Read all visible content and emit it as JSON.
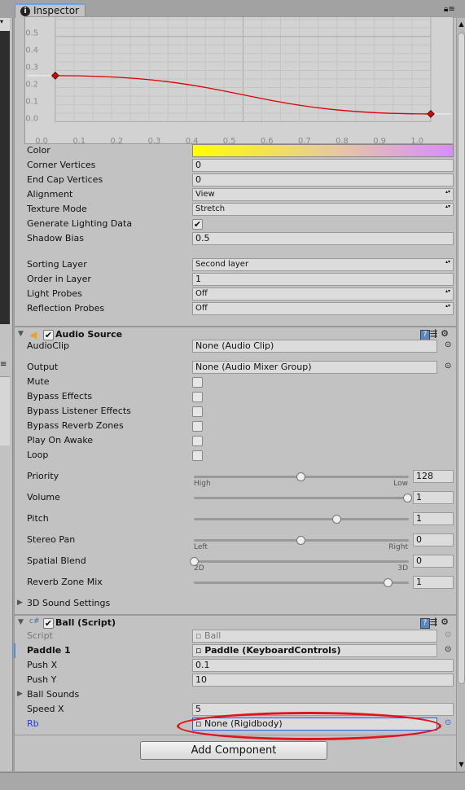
{
  "window": {
    "tab_label": "Inspector",
    "tab_icon": "info-icon"
  },
  "curve": {
    "chart_data": {
      "type": "line",
      "x_ticks": [
        "0.0",
        "0.1",
        "0.2",
        "0.3",
        "0.4",
        "0.5",
        "0.6",
        "0.7",
        "0.8",
        "0.9",
        "1.0"
      ],
      "y_ticks": [
        "0.0",
        "0.1",
        "0.2",
        "0.3",
        "0.4",
        "0.5"
      ],
      "xlim": [
        0,
        1
      ],
      "ylim": [
        0,
        0.5
      ],
      "keys": [
        {
          "x": 0,
          "y": 0.27
        },
        {
          "x": 1,
          "y": 0.045
        }
      ],
      "color": "#e00000",
      "grid": true
    }
  },
  "line_renderer": {
    "rows": [
      {
        "label": "Color",
        "kind": "gradient",
        "colors": [
          "#ffff00",
          "#d88cff"
        ]
      },
      {
        "label": "Corner Vertices",
        "kind": "text",
        "value": "0"
      },
      {
        "label": "End Cap Vertices",
        "kind": "text",
        "value": "0"
      },
      {
        "label": "Alignment",
        "kind": "dropdown",
        "value": "View"
      },
      {
        "label": "Texture Mode",
        "kind": "dropdown",
        "value": "Stretch"
      },
      {
        "label": "Generate Lighting Data",
        "kind": "checkbox",
        "checked": true
      },
      {
        "label": "Shadow Bias",
        "kind": "text",
        "value": "0.5"
      },
      {
        "label": "Sorting Layer",
        "kind": "dropdown",
        "value": "Second layer"
      },
      {
        "label": "Order in Layer",
        "kind": "text",
        "value": "1"
      },
      {
        "label": "Light Probes",
        "kind": "dropdown",
        "value": "Off"
      },
      {
        "label": "Reflection Probes",
        "kind": "dropdown",
        "value": "Off"
      }
    ]
  },
  "audio_source": {
    "title": "Audio Source",
    "enabled": true,
    "rows": [
      {
        "label": "AudioClip",
        "kind": "object",
        "value": "None (Audio Clip)"
      },
      {
        "label": "Output",
        "kind": "object",
        "value": "None (Audio Mixer Group)"
      },
      {
        "label": "Mute",
        "kind": "checkbox",
        "checked": false
      },
      {
        "label": "Bypass Effects",
        "kind": "checkbox",
        "checked": false
      },
      {
        "label": "Bypass Listener Effects",
        "kind": "checkbox",
        "checked": false
      },
      {
        "label": "Bypass Reverb Zones",
        "kind": "checkbox",
        "checked": false
      },
      {
        "label": "Play On Awake",
        "kind": "checkbox",
        "checked": false
      },
      {
        "label": "Loop",
        "kind": "checkbox",
        "checked": false
      },
      {
        "label": "Priority",
        "kind": "slider",
        "value": "128",
        "fraction": 0.5,
        "left": "High",
        "right": "Low"
      },
      {
        "label": "Volume",
        "kind": "slider",
        "value": "1",
        "fraction": 1.0
      },
      {
        "label": "Pitch",
        "kind": "slider",
        "value": "1",
        "fraction": 0.667
      },
      {
        "label": "Stereo Pan",
        "kind": "slider",
        "value": "0",
        "fraction": 0.5,
        "left": "Left",
        "right": "Right"
      },
      {
        "label": "Spatial Blend",
        "kind": "slider",
        "value": "0",
        "fraction": 0.0,
        "left": "2D",
        "right": "3D"
      },
      {
        "label": "Reverb Zone Mix",
        "kind": "slider",
        "value": "1",
        "fraction": 0.909
      },
      {
        "label": "3D Sound Settings",
        "kind": "foldout"
      }
    ]
  },
  "ball_script": {
    "title": "Ball (Script)",
    "enabled": true,
    "rows": [
      {
        "label": "Script",
        "kind": "object",
        "value": "Ball",
        "style": "disabled"
      },
      {
        "label": "Paddle 1",
        "kind": "object",
        "value": "Paddle (KeyboardControls)",
        "style": "bold"
      },
      {
        "label": "Push X",
        "kind": "text",
        "value": "0.1"
      },
      {
        "label": "Push Y",
        "kind": "text",
        "value": "10"
      },
      {
        "label": "Ball Sounds",
        "kind": "foldout"
      },
      {
        "label": "Speed X",
        "kind": "text",
        "value": "5"
      },
      {
        "label": "Rb",
        "kind": "object",
        "value": "None (Rigidbody)",
        "style": "selected"
      }
    ]
  },
  "add_component_label": "Add Component",
  "annotation": {
    "shape": "ellipse",
    "color": "#e0141c",
    "target": "Rb"
  }
}
